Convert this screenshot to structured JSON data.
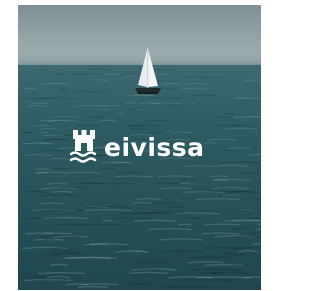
{
  "brand": {
    "name": "eivissa",
    "emblem": "castle-tower-waves-icon",
    "text_color": "#ffffff"
  },
  "scene": {
    "subject": "sailboat",
    "sea_color": "#2a565c",
    "sky_color": "#93a4a7"
  }
}
